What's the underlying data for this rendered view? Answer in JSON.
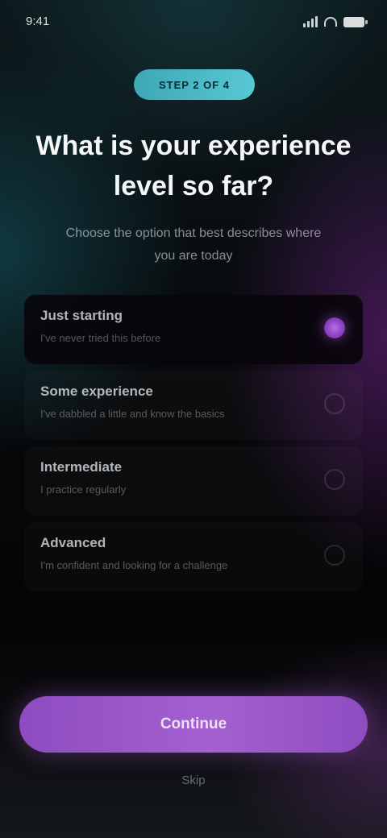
{
  "status_bar": {
    "time": "9:41"
  },
  "header": {
    "badge": "Step 2 of 4",
    "title": "What is your experience level so far?",
    "subtitle": "Choose the option that best describes where you are today"
  },
  "options": [
    {
      "title": "Just starting",
      "description": "I've never tried this before",
      "selected": true
    },
    {
      "title": "Some experience",
      "description": "I've dabbled a little and know the basics",
      "selected": false
    },
    {
      "title": "Intermediate",
      "description": "I practice regularly",
      "selected": false
    },
    {
      "title": "Advanced",
      "description": "I'm confident and looking for a challenge",
      "selected": false
    }
  ],
  "actions": {
    "continue_label": "Continue",
    "skip_label": "Skip"
  },
  "colors": {
    "accent_teal": "#58c7d4",
    "accent_purple": "#a460d0"
  }
}
